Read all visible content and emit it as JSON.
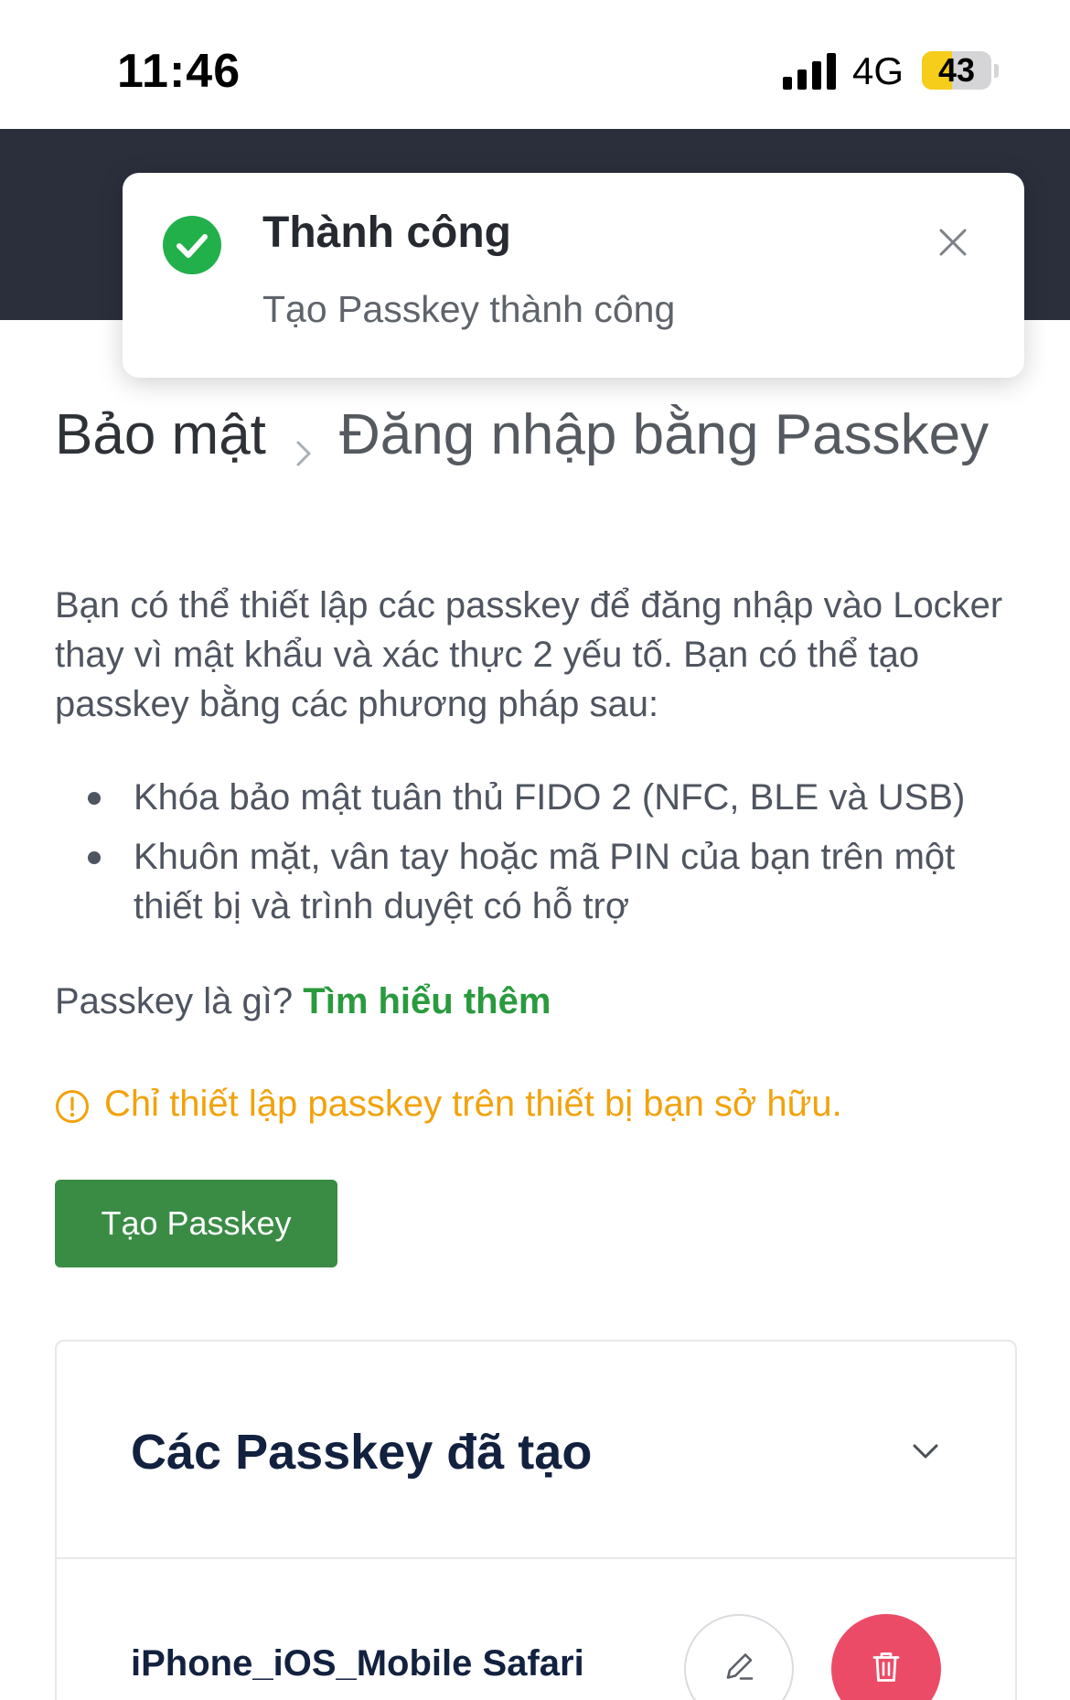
{
  "status_bar": {
    "time": "11:46",
    "network": "4G",
    "battery_level": "43"
  },
  "toast": {
    "title": "Thành công",
    "message": "Tạo Passkey thành công",
    "icon": "check-circle-icon",
    "close_icon": "close-icon",
    "accent_color": "#22b04b"
  },
  "breadcrumb": {
    "parent": "Bảo mật",
    "current": "Đăng nhập bằng Passkey"
  },
  "intro_text": "Bạn có thể thiết lập các passkey để đăng nhập vào Locker thay vì mật khẩu và xác thực 2 yếu tố. Bạn có thể tạo passkey bằng các phương pháp sau:",
  "methods": [
    "Khóa bảo mật tuân thủ FIDO 2 (NFC, BLE và USB)",
    "Khuôn mặt, vân tay hoặc mã PIN của bạn trên một thiết bị và trình duyệt có hỗ trợ"
  ],
  "learn_more": {
    "question": "Passkey là gì?",
    "link": "Tìm hiểu thêm"
  },
  "warning": {
    "text": "Chỉ thiết lập passkey trên thiết bị bạn sở hữu.",
    "icon": "exclamation-circle-icon",
    "color": "#f2a20c"
  },
  "create_button": {
    "label": "Tạo Passkey",
    "color": "#3a8c45"
  },
  "passkey_card": {
    "title": "Các Passkey đã tạo",
    "chevron_icon": "chevron-down-icon",
    "items": [
      {
        "name": "iPhone_iOS_Mobile Safari",
        "edit_icon": "pencil-icon",
        "delete_icon": "trash-icon",
        "delete_color": "#ec4b68"
      }
    ]
  },
  "colors": {
    "header_dark": "#2b2f3c",
    "link_green": "#2a9a3e",
    "title_navy": "#12213f"
  }
}
